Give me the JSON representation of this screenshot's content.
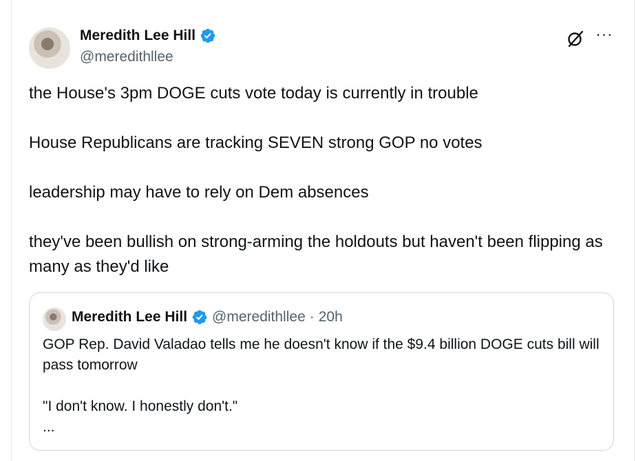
{
  "author": {
    "name": "Meredith Lee Hill",
    "handle": "@meredithllee",
    "verified": true,
    "verified_color": "#1d9bf0"
  },
  "actions": {
    "grok_icon": "grok-icon",
    "more_label": "···"
  },
  "tweet": {
    "lines": [
      "the House's 3pm DOGE cuts vote today is currently in trouble",
      "House Republicans are tracking SEVEN strong GOP no votes",
      "leadership may have to rely on Dem absences",
      "they've been bullish on strong-arming the holdouts but haven't been flipping as many as they'd like"
    ]
  },
  "quoted": {
    "name": "Meredith Lee Hill",
    "handle": "@meredithllee",
    "separator": "·",
    "time": "20h",
    "lines": [
      "GOP Rep. David Valadao tells me he doesn't know if the $9.4 billion DOGE cuts bill will pass tomorrow",
      "\"I don't know. I honestly don't.\"",
      "..."
    ]
  }
}
